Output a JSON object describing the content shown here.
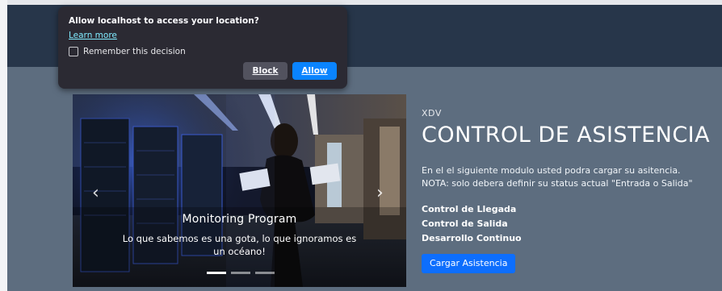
{
  "permission_popup": {
    "title": "Allow localhost to access your location?",
    "learn_more": "Learn more",
    "remember_label": "Remember this decision",
    "remember_checked": false,
    "block_label": "Block",
    "allow_label": "Allow"
  },
  "carousel": {
    "caption_title": "Monitoring Program",
    "caption_text": "Lo que sabemos es una gota, lo que ignoramos es un océano!",
    "prev_icon": "‹",
    "next_icon": "›",
    "slide_count": 3,
    "active_slide": 1
  },
  "hero": {
    "brand": "XDV",
    "title": "CONTROL DE ASISTENCIA",
    "description_line1": "En el el siguiente modulo usted podra cargar su asitencia.",
    "description_line2": "NOTA: solo debera definir su status actual \"Entrada o Salida\"",
    "features": [
      "Control de Llegada",
      "Control de Salida",
      "Desarrollo Continuo"
    ],
    "cta_label": "Cargar Asistencia"
  },
  "colors": {
    "navbar": "#27364a",
    "content_bg": "#5d6d7f",
    "primary_button": "#0d6efd",
    "popup_bg": "#2b2a33",
    "allow_button": "#0a84ff"
  }
}
